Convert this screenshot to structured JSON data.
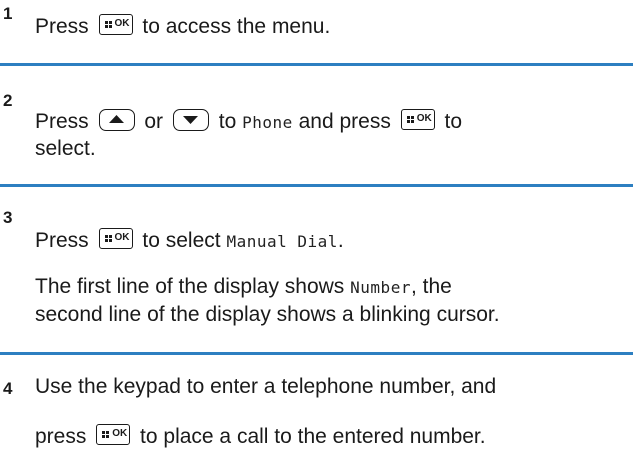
{
  "icons": {
    "ok": "ok-key-icon",
    "up": "up-arrow-key-icon",
    "down": "down-arrow-key-icon"
  },
  "ok_key_text": "OK",
  "accent_color": "#2d7fc1",
  "steps": [
    {
      "number": "1",
      "pre": "Press",
      "post": "to access the menu."
    },
    {
      "number": "2",
      "pre": "Press",
      "or": "or",
      "to": "to",
      "menu_item": "Phone",
      "and_press": "and press",
      "post": "to",
      "line2": "select."
    },
    {
      "number": "3",
      "pre": "Press",
      "to_select": "to select",
      "menu_item": "Manual Dial",
      "period": ".",
      "result_line1_a": "The first line of the display shows",
      "result_display": "Number",
      "result_line1_b": ", the",
      "result_line2": "second line of the display shows a blinking cursor."
    },
    {
      "number": "4",
      "line1": "Use the keypad to enter a telephone number, and",
      "pre": "press",
      "post": "to place a call to the entered number."
    }
  ]
}
